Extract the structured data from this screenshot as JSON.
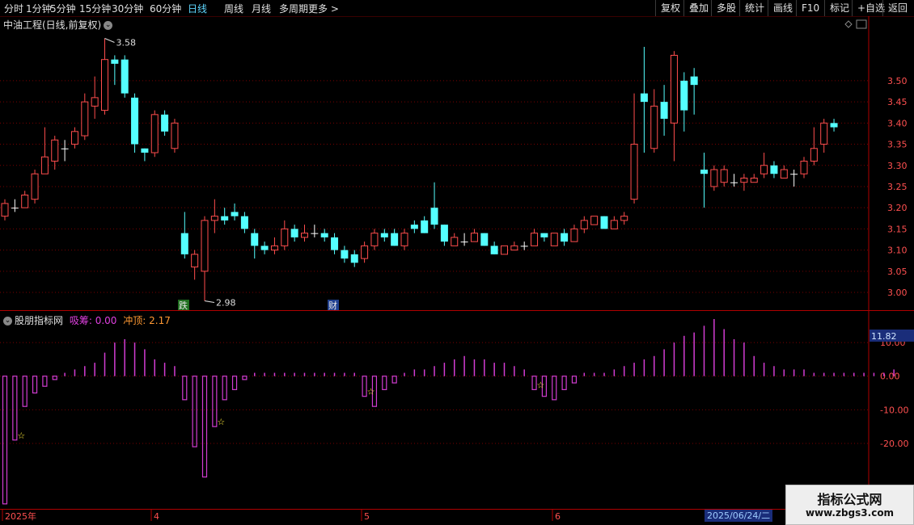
{
  "toolbar": {
    "periods": [
      "分时",
      "1分钟",
      "5分钟",
      "15分钟",
      "30分钟",
      "60分钟",
      "日线",
      "周线",
      "月线",
      "多周期",
      "更多 >"
    ],
    "active_period": "日线",
    "right_buttons": [
      "复权",
      "叠加",
      "多股",
      "统计",
      "画线",
      "F10",
      "标记",
      "+自选",
      "返回"
    ]
  },
  "main_panel": {
    "title": "中油工程(日线,前复权)",
    "high_marker": "3.58",
    "low_marker": "2.98",
    "event_tags": [
      "跌",
      "财"
    ],
    "price_axis": [
      "3.50",
      "3.45",
      "3.40",
      "3.35",
      "3.30",
      "3.25",
      "3.20",
      "3.15",
      "3.10",
      "3.05",
      "3.00"
    ]
  },
  "sub_panel": {
    "name": "股朋指标网",
    "items": [
      {
        "label": "吸筹:",
        "value": "0.00",
        "color": "#e040e0"
      },
      {
        "label": "冲顶:",
        "value": "2.17",
        "color": "#ff9933"
      }
    ],
    "current_value": "11.82",
    "axis": [
      "10.00",
      "0.00",
      "-10.00",
      "-20.00"
    ]
  },
  "time_axis": {
    "labels": [
      "2025年",
      "4",
      "5",
      "6"
    ],
    "cursor_date": "2025/06/24/二"
  },
  "watermark": {
    "line1": "指标公式网",
    "line2": "www.zbgs3.com"
  },
  "colors": {
    "up": "#ff4d4d",
    "down": "#54ffff",
    "flat": "#ffffff",
    "bar": "#d23cd2",
    "grid": "#7a0000",
    "axis": "#b00000"
  },
  "chart_data": {
    "type": "candlestick",
    "candles": [
      {
        "o": 3.18,
        "c": 3.21,
        "h": 3.22,
        "l": 3.17
      },
      {
        "o": 3.2,
        "c": 3.2,
        "h": 3.22,
        "l": 3.19
      },
      {
        "o": 3.2,
        "c": 3.23,
        "h": 3.24,
        "l": 3.2
      },
      {
        "o": 3.22,
        "c": 3.28,
        "h": 3.29,
        "l": 3.21
      },
      {
        "o": 3.28,
        "c": 3.32,
        "h": 3.39,
        "l": 3.28
      },
      {
        "o": 3.31,
        "c": 3.36,
        "h": 3.37,
        "l": 3.29
      },
      {
        "o": 3.34,
        "c": 3.34,
        "h": 3.36,
        "l": 3.31
      },
      {
        "o": 3.35,
        "c": 3.38,
        "h": 3.39,
        "l": 3.34
      },
      {
        "o": 3.37,
        "c": 3.45,
        "h": 3.47,
        "l": 3.36
      },
      {
        "o": 3.44,
        "c": 3.46,
        "h": 3.51,
        "l": 3.41
      },
      {
        "o": 3.43,
        "c": 3.55,
        "h": 3.6,
        "l": 3.42
      },
      {
        "o": 3.55,
        "c": 3.54,
        "h": 3.56,
        "l": 3.49
      },
      {
        "o": 3.55,
        "c": 3.47,
        "h": 3.56,
        "l": 3.46
      },
      {
        "o": 3.46,
        "c": 3.35,
        "h": 3.47,
        "l": 3.33
      },
      {
        "o": 3.34,
        "c": 3.33,
        "h": 3.34,
        "l": 3.31
      },
      {
        "o": 3.33,
        "c": 3.42,
        "h": 3.43,
        "l": 3.32
      },
      {
        "o": 3.42,
        "c": 3.38,
        "h": 3.43,
        "l": 3.37
      },
      {
        "o": 3.34,
        "c": 3.4,
        "h": 3.41,
        "l": 3.33
      },
      {
        "o": 3.14,
        "c": 3.09,
        "h": 3.19,
        "l": 3.08
      },
      {
        "o": 3.06,
        "c": 3.09,
        "h": 3.1,
        "l": 3.03
      },
      {
        "o": 3.05,
        "c": 3.17,
        "h": 3.18,
        "l": 2.98
      },
      {
        "o": 3.17,
        "c": 3.18,
        "h": 3.22,
        "l": 3.14
      },
      {
        "o": 3.18,
        "c": 3.17,
        "h": 3.2,
        "l": 3.16
      },
      {
        "o": 3.19,
        "c": 3.18,
        "h": 3.21,
        "l": 3.17
      },
      {
        "o": 3.18,
        "c": 3.15,
        "h": 3.19,
        "l": 3.14
      },
      {
        "o": 3.14,
        "c": 3.11,
        "h": 3.15,
        "l": 3.08
      },
      {
        "o": 3.11,
        "c": 3.1,
        "h": 3.12,
        "l": 3.09
      },
      {
        "o": 3.1,
        "c": 3.11,
        "h": 3.13,
        "l": 3.09
      },
      {
        "o": 3.11,
        "c": 3.15,
        "h": 3.17,
        "l": 3.1
      },
      {
        "o": 3.15,
        "c": 3.13,
        "h": 3.16,
        "l": 3.12
      },
      {
        "o": 3.13,
        "c": 3.14,
        "h": 3.16,
        "l": 3.12
      },
      {
        "o": 3.14,
        "c": 3.14,
        "h": 3.16,
        "l": 3.13
      },
      {
        "o": 3.14,
        "c": 3.13,
        "h": 3.15,
        "l": 3.12
      },
      {
        "o": 3.13,
        "c": 3.1,
        "h": 3.14,
        "l": 3.09
      },
      {
        "o": 3.1,
        "c": 3.08,
        "h": 3.11,
        "l": 3.07
      },
      {
        "o": 3.09,
        "c": 3.07,
        "h": 3.1,
        "l": 3.06
      },
      {
        "o": 3.08,
        "c": 3.11,
        "h": 3.12,
        "l": 3.07
      },
      {
        "o": 3.11,
        "c": 3.14,
        "h": 3.15,
        "l": 3.1
      },
      {
        "o": 3.14,
        "c": 3.13,
        "h": 3.15,
        "l": 3.12
      },
      {
        "o": 3.14,
        "c": 3.11,
        "h": 3.15,
        "l": 3.11
      },
      {
        "o": 3.11,
        "c": 3.14,
        "h": 3.15,
        "l": 3.1
      },
      {
        "o": 3.16,
        "c": 3.15,
        "h": 3.17,
        "l": 3.14
      },
      {
        "o": 3.17,
        "c": 3.14,
        "h": 3.18,
        "l": 3.14
      },
      {
        "o": 3.2,
        "c": 3.16,
        "h": 3.26,
        "l": 3.15
      },
      {
        "o": 3.16,
        "c": 3.12,
        "h": 3.16,
        "l": 3.11
      },
      {
        "o": 3.11,
        "c": 3.13,
        "h": 3.14,
        "l": 3.11
      },
      {
        "o": 3.12,
        "c": 3.12,
        "h": 3.14,
        "l": 3.11
      },
      {
        "o": 3.12,
        "c": 3.14,
        "h": 3.15,
        "l": 3.12
      },
      {
        "o": 3.14,
        "c": 3.11,
        "h": 3.14,
        "l": 3.11
      },
      {
        "o": 3.11,
        "c": 3.09,
        "h": 3.12,
        "l": 3.09
      },
      {
        "o": 3.09,
        "c": 3.11,
        "h": 3.11,
        "l": 3.09
      },
      {
        "o": 3.1,
        "c": 3.11,
        "h": 3.12,
        "l": 3.1
      },
      {
        "o": 3.11,
        "c": 3.11,
        "h": 3.12,
        "l": 3.1
      },
      {
        "o": 3.11,
        "c": 3.14,
        "h": 3.15,
        "l": 3.11
      },
      {
        "o": 3.14,
        "c": 3.13,
        "h": 3.14,
        "l": 3.12
      },
      {
        "o": 3.11,
        "c": 3.14,
        "h": 3.14,
        "l": 3.11
      },
      {
        "o": 3.14,
        "c": 3.12,
        "h": 3.15,
        "l": 3.11
      },
      {
        "o": 3.12,
        "c": 3.15,
        "h": 3.16,
        "l": 3.12
      },
      {
        "o": 3.15,
        "c": 3.17,
        "h": 3.18,
        "l": 3.14
      },
      {
        "o": 3.16,
        "c": 3.18,
        "h": 3.18,
        "l": 3.16
      },
      {
        "o": 3.18,
        "c": 3.15,
        "h": 3.18,
        "l": 3.15
      },
      {
        "o": 3.15,
        "c": 3.17,
        "h": 3.18,
        "l": 3.15
      },
      {
        "o": 3.17,
        "c": 3.18,
        "h": 3.19,
        "l": 3.16
      },
      {
        "o": 3.22,
        "c": 3.35,
        "h": 3.47,
        "l": 3.21
      },
      {
        "o": 3.47,
        "c": 3.45,
        "h": 3.58,
        "l": 3.33
      },
      {
        "o": 3.34,
        "c": 3.44,
        "h": 3.48,
        "l": 3.33
      },
      {
        "o": 3.45,
        "c": 3.41,
        "h": 3.49,
        "l": 3.37
      },
      {
        "o": 3.4,
        "c": 3.56,
        "h": 3.57,
        "l": 3.31
      },
      {
        "o": 3.5,
        "c": 3.43,
        "h": 3.52,
        "l": 3.38
      },
      {
        "o": 3.51,
        "c": 3.49,
        "h": 3.53,
        "l": 3.42
      },
      {
        "o": 3.29,
        "c": 3.28,
        "h": 3.33,
        "l": 3.2
      },
      {
        "o": 3.25,
        "c": 3.29,
        "h": 3.3,
        "l": 3.24
      },
      {
        "o": 3.26,
        "c": 3.29,
        "h": 3.3,
        "l": 3.25
      },
      {
        "o": 3.26,
        "c": 3.26,
        "h": 3.28,
        "l": 3.25
      },
      {
        "o": 3.26,
        "c": 3.27,
        "h": 3.28,
        "l": 3.24
      },
      {
        "o": 3.26,
        "c": 3.27,
        "h": 3.28,
        "l": 3.26
      },
      {
        "o": 3.28,
        "c": 3.3,
        "h": 3.33,
        "l": 3.27
      },
      {
        "o": 3.3,
        "c": 3.28,
        "h": 3.31,
        "l": 3.27
      },
      {
        "o": 3.27,
        "c": 3.29,
        "h": 3.3,
        "l": 3.27
      },
      {
        "o": 3.28,
        "c": 3.28,
        "h": 3.29,
        "l": 3.25
      },
      {
        "o": 3.28,
        "c": 3.31,
        "h": 3.32,
        "l": 3.27
      },
      {
        "o": 3.31,
        "c": 3.34,
        "h": 3.39,
        "l": 3.3
      },
      {
        "o": 3.35,
        "c": 3.4,
        "h": 3.41,
        "l": 3.33
      },
      {
        "o": 3.4,
        "c": 3.39,
        "h": 3.41,
        "l": 3.38
      }
    ],
    "indicator_values": [
      -38,
      -19,
      -9,
      -5,
      -3,
      -1,
      1,
      2,
      3,
      4,
      7,
      10,
      11,
      10,
      8,
      5,
      4,
      3,
      -7,
      -21,
      -30,
      -15,
      -7,
      -4,
      -1,
      1,
      1,
      1,
      1,
      1,
      1,
      1,
      1,
      1,
      1,
      1,
      -6,
      -9,
      -4,
      -2,
      1,
      2,
      2,
      3,
      4,
      5,
      6,
      5,
      5,
      4,
      4,
      3,
      2,
      -4,
      -6,
      -7,
      -4,
      -2,
      1,
      1,
      1,
      2,
      3,
      4,
      5,
      6,
      8,
      10,
      12,
      13,
      15,
      17,
      14,
      11,
      10,
      6,
      4,
      3,
      2,
      2,
      2,
      1,
      1,
      1,
      1,
      1,
      1,
      1,
      1,
      2
    ],
    "indicator_name": "股朋指标网",
    "star_indices": [
      1,
      21,
      36,
      53
    ],
    "price_ylim": [
      2.96,
      3.62
    ],
    "indicator_ylim": [
      -39,
      17
    ]
  }
}
